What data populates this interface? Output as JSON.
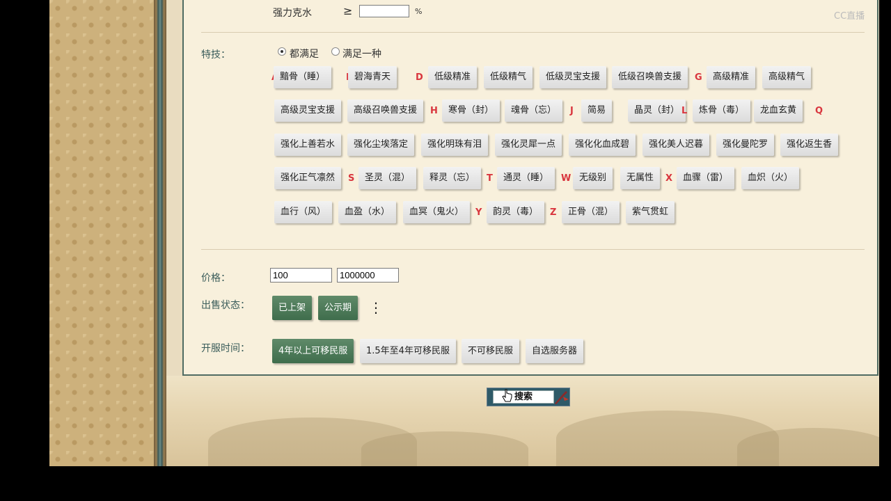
{
  "watermark": "CC直播",
  "filters": {
    "resist_label": "强力克水",
    "resist_operator": "≥",
    "resist_value": "",
    "resist_unit": "%",
    "skills_label": "特技：",
    "radio_all": "都满足",
    "radio_any": "满足一种",
    "skill_groups": [
      {
        "letter": "A",
        "items": [
          "黯骨（睡）"
        ]
      },
      {
        "letter": "B",
        "items": [
          "碧海青天"
        ]
      },
      {
        "letter": "D",
        "items": [
          "低级精准",
          "低级精气",
          "低级灵宝支援",
          "低级召唤兽支援"
        ]
      },
      {
        "letter": "G",
        "items": [
          "高级精准",
          "高级精气",
          "高级灵宝支援",
          "高级召唤兽支援"
        ]
      },
      {
        "letter": "H",
        "items": [
          "寒骨（封）",
          "魂骨（忘）"
        ]
      },
      {
        "letter": "J",
        "items": [
          "简易",
          "晶灵（封）"
        ]
      },
      {
        "letter": "L",
        "items": [
          "炼骨（毒）",
          "龙血玄黄"
        ]
      },
      {
        "letter": "Q",
        "items": [
          "强化上善若水",
          "强化尘埃落定",
          "强化明珠有泪",
          "强化灵犀一点",
          "强化化血成碧",
          "强化美人迟暮",
          "强化曼陀罗",
          "强化返生香",
          "强化正气凛然"
        ]
      },
      {
        "letter": "S",
        "items": [
          "圣灵（混）",
          "释灵（忘）"
        ]
      },
      {
        "letter": "T",
        "items": [
          "通灵（睡）"
        ]
      },
      {
        "letter": "W",
        "items": [
          "无级别",
          "无属性"
        ]
      },
      {
        "letter": "X",
        "items": [
          "血骤（雷）",
          "血炽（火）",
          "血行（风）",
          "血盈（水）",
          "血冥（鬼火）"
        ]
      },
      {
        "letter": "Y",
        "items": [
          "韵灵（毒）"
        ]
      },
      {
        "letter": "Z",
        "items": [
          "正骨（混）",
          "紫气贯虹"
        ]
      }
    ],
    "price_label": "价格：",
    "price_min": "100",
    "price_max": "1000000",
    "sale_status_label": "出售状态：",
    "sale_status_options": [
      "已上架",
      "公示期"
    ],
    "more_icon": "⋮",
    "server_time_label": "开服时间：",
    "server_time_options": [
      "4年以上可移民服",
      "1.5年至4年可移民服",
      "不可移民服",
      "自选服务器"
    ]
  },
  "search": {
    "label": "搜索"
  }
}
